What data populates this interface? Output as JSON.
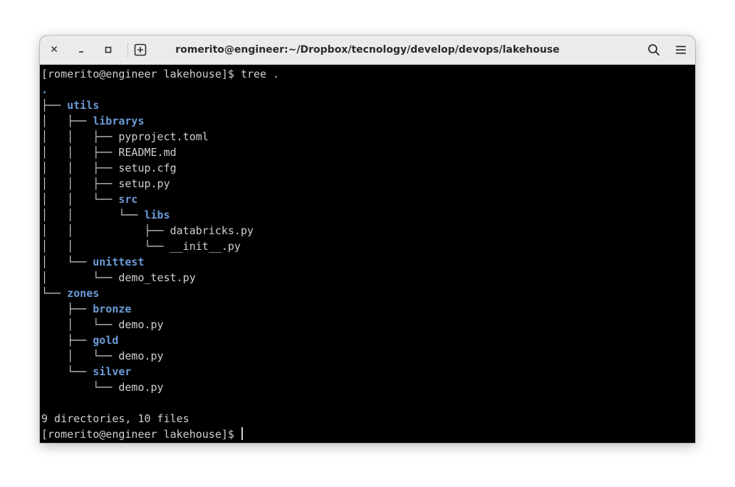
{
  "window": {
    "title": "romerito@engineer:~/Dropbox/tecnology/develop/devops/lakehouse",
    "close_glyph": "✕",
    "minimize_glyph": "‒"
  },
  "terminal": {
    "prompt": "[romerito@engineer lakehouse]$",
    "command": "tree .",
    "root": ".",
    "tree": [
      {
        "prefix": "├── ",
        "name": "utils",
        "type": "dir"
      },
      {
        "prefix": "│   ├── ",
        "name": "librarys",
        "type": "dir"
      },
      {
        "prefix": "│   │   ├── ",
        "name": "pyproject.toml",
        "type": "file"
      },
      {
        "prefix": "│   │   ├── ",
        "name": "README.md",
        "type": "file"
      },
      {
        "prefix": "│   │   ├── ",
        "name": "setup.cfg",
        "type": "file"
      },
      {
        "prefix": "│   │   ├── ",
        "name": "setup.py",
        "type": "file"
      },
      {
        "prefix": "│   │   └── ",
        "name": "src",
        "type": "dir"
      },
      {
        "prefix": "│   │       └── ",
        "name": "libs",
        "type": "dir"
      },
      {
        "prefix": "│   │           ├── ",
        "name": "databricks.py",
        "type": "file"
      },
      {
        "prefix": "│   │           └── ",
        "name": "__init__.py",
        "type": "file"
      },
      {
        "prefix": "│   └── ",
        "name": "unittest",
        "type": "dir"
      },
      {
        "prefix": "│       └── ",
        "name": "demo_test.py",
        "type": "file"
      },
      {
        "prefix": "└── ",
        "name": "zones",
        "type": "dir"
      },
      {
        "prefix": "    ├── ",
        "name": "bronze",
        "type": "dir"
      },
      {
        "prefix": "    │   └── ",
        "name": "demo.py",
        "type": "file"
      },
      {
        "prefix": "    ├── ",
        "name": "gold",
        "type": "dir"
      },
      {
        "prefix": "    │   └── ",
        "name": "demo.py",
        "type": "file"
      },
      {
        "prefix": "    └── ",
        "name": "silver",
        "type": "dir"
      },
      {
        "prefix": "        └── ",
        "name": "demo.py",
        "type": "file"
      }
    ],
    "summary": "9 directories, 10 files",
    "final_prompt": "[romerito@engineer lakehouse]$"
  },
  "icons": [
    "close-icon",
    "minimize-icon",
    "maximize-icon",
    "new-tab-icon",
    "search-icon",
    "hamburger-menu-icon"
  ],
  "colors": {
    "titlebar_bg": "#ebebeb",
    "terminal_bg": "#000000",
    "terminal_fg": "#d0d0d0",
    "directory": "#6b9bd8"
  }
}
